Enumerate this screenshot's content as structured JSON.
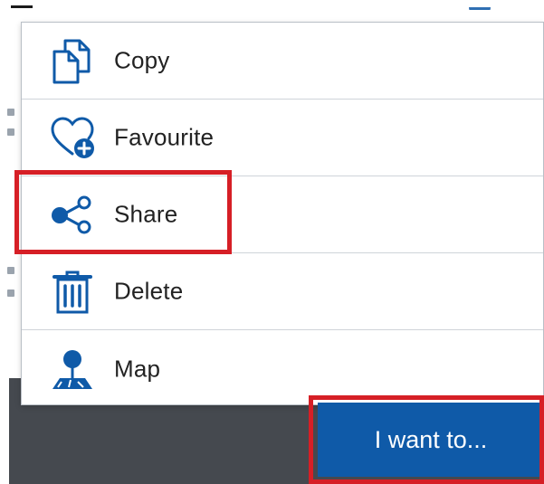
{
  "menu": {
    "items": [
      {
        "label": "Copy",
        "icon": "copy-icon"
      },
      {
        "label": "Favourite",
        "icon": "favourite-add-icon"
      },
      {
        "label": "Share",
        "icon": "share-icon"
      },
      {
        "label": "Delete",
        "icon": "trash-icon"
      },
      {
        "label": "Map",
        "icon": "map-pin-icon"
      }
    ]
  },
  "actions": {
    "i_want_to_label": "I want to..."
  },
  "colors": {
    "accent": "#0f5aa8",
    "highlight": "#d61f26",
    "footer": "#45494f",
    "menu_border": "#b9bfc6"
  }
}
